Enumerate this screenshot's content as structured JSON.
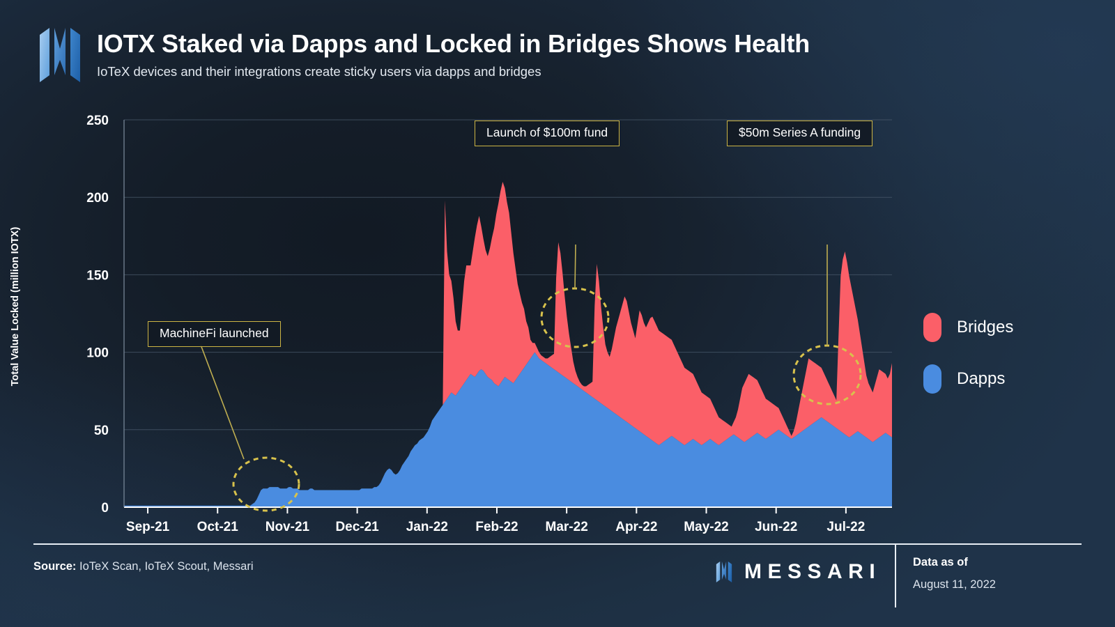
{
  "header": {
    "title": "IOTX Staked via Dapps and Locked in Bridges Shows Health",
    "subtitle": "IoTeX devices and their integrations create sticky users via dapps and bridges",
    "logo_icon": "messari-logo-icon"
  },
  "legend": {
    "items": [
      {
        "label": "Bridges",
        "color": "#fb5f68"
      },
      {
        "label": "Dapps",
        "color": "#4a8ce0"
      }
    ]
  },
  "annotations": [
    {
      "id": "machinefi",
      "label": "MachineFi launched"
    },
    {
      "id": "fund100m",
      "label": "Launch of $100m fund"
    },
    {
      "id": "series-a",
      "label": "$50m Series A funding"
    }
  ],
  "footer": {
    "source_label": "Source:",
    "source_value": "IoTeX Scan, IoTeX Scout, Messari",
    "brand": "MESSARI",
    "brand_logo_icon": "messari-logo-icon",
    "data_as_of_label": "Data as of",
    "data_as_of_value": "August 11, 2022"
  },
  "chart_data": {
    "type": "area",
    "stacked": true,
    "title": "IOTX Staked via Dapps and Locked in Bridges Shows Health",
    "subtitle": "IoTeX devices and their integrations create sticky users via dapps and bridges",
    "xlabel": "",
    "ylabel": "Total Value Locked (million IOTX)",
    "ylim": [
      0,
      250
    ],
    "yticks": [
      0,
      50,
      100,
      150,
      200,
      250
    ],
    "xticks": [
      "Sep-21",
      "Oct-21",
      "Nov-21",
      "Dec-21",
      "Jan-22",
      "Feb-22",
      "Mar-22",
      "Apr-22",
      "May-22",
      "Jun-22",
      "Jul-22"
    ],
    "grid": true,
    "legend_position": "right",
    "x_range": [
      "2021-09-01",
      "2022-08-11"
    ],
    "annotations": [
      {
        "text": "MachineFi launched",
        "x": "2021-11-05",
        "y": 12
      },
      {
        "text": "Launch of $100m fund",
        "x": "2022-03-10",
        "y": 195
      },
      {
        "text": "$50m Series A funding",
        "x": "2022-07-05",
        "y": 150
      }
    ],
    "series": [
      {
        "name": "Dapps",
        "color": "#4a8ce0",
        "values": [
          1,
          1,
          1,
          1,
          1,
          1,
          1,
          1,
          1,
          1,
          1,
          1,
          1,
          1,
          1,
          1,
          1,
          1,
          1,
          1,
          1,
          1,
          1,
          1,
          1,
          1,
          1,
          1,
          1,
          1,
          1,
          1,
          1,
          1,
          1,
          1,
          1,
          1,
          1,
          1,
          1,
          1,
          1,
          1,
          1,
          1,
          1,
          1,
          1,
          1,
          1,
          1,
          1,
          1,
          1,
          1,
          1,
          1,
          1,
          1,
          2,
          3,
          5,
          8,
          11,
          12,
          12,
          12,
          13,
          13,
          13,
          13,
          13,
          12,
          12,
          12,
          12,
          13,
          13,
          12,
          12,
          12,
          11,
          11,
          11,
          11,
          11,
          12,
          12,
          11,
          11,
          11,
          11,
          11,
          11,
          11,
          11,
          11,
          11,
          11,
          11,
          11,
          11,
          11,
          11,
          11,
          11,
          11,
          11,
          11,
          11,
          12,
          12,
          12,
          12,
          12,
          12,
          13,
          13,
          14,
          16,
          19,
          22,
          24,
          25,
          24,
          22,
          21,
          22,
          24,
          27,
          29,
          31,
          33,
          36,
          38,
          40,
          41,
          43,
          44,
          45,
          47,
          49,
          52,
          56,
          58,
          60,
          62,
          64,
          66,
          68,
          70,
          72,
          74,
          73,
          72,
          74,
          76,
          78,
          80,
          82,
          84,
          86,
          85,
          84,
          86,
          88,
          89,
          88,
          86,
          84,
          83,
          82,
          80,
          79,
          78,
          80,
          82,
          84,
          83,
          82,
          81,
          80,
          82,
          84,
          86,
          88,
          90,
          92,
          94,
          96,
          98,
          100,
          98,
          96,
          95,
          94,
          93,
          92,
          91,
          90,
          89,
          88,
          87,
          86,
          85,
          84,
          83,
          82,
          81,
          80,
          79,
          78,
          77,
          76,
          75,
          74,
          73,
          72,
          71,
          70,
          69,
          68,
          67,
          66,
          65,
          64,
          63,
          62,
          61,
          60,
          59,
          58,
          57,
          56,
          55,
          54,
          53,
          52,
          51,
          50,
          49,
          48,
          47,
          46,
          45,
          44,
          43,
          42,
          41,
          40,
          41,
          42,
          43,
          44,
          45,
          46,
          45,
          44,
          43,
          42,
          41,
          40,
          41,
          42,
          43,
          44,
          43,
          42,
          41,
          40,
          41,
          42,
          43,
          44,
          43,
          42,
          41,
          40,
          41,
          42,
          43,
          44,
          45,
          46,
          47,
          46,
          45,
          44,
          43,
          42,
          43,
          44,
          45,
          46,
          47,
          48,
          47,
          46,
          45,
          44,
          45,
          46,
          47,
          48,
          49,
          50,
          49,
          48,
          47,
          46,
          45,
          44,
          45,
          46,
          47,
          48,
          49,
          50,
          51,
          52,
          53,
          54,
          55,
          56,
          57,
          58,
          57,
          56,
          55,
          54,
          53,
          52,
          51,
          50,
          49,
          48,
          47,
          46,
          45,
          46,
          47,
          48,
          49,
          48,
          47,
          46,
          45,
          44,
          43,
          42,
          43,
          44,
          45,
          46,
          47,
          48,
          47,
          46,
          45
        ]
      },
      {
        "name": "Bridges",
        "color": "#fb5f68",
        "values": [
          0,
          0,
          0,
          0,
          0,
          0,
          0,
          0,
          0,
          0,
          0,
          0,
          0,
          0,
          0,
          0,
          0,
          0,
          0,
          0,
          0,
          0,
          0,
          0,
          0,
          0,
          0,
          0,
          0,
          0,
          0,
          0,
          0,
          0,
          0,
          0,
          0,
          0,
          0,
          0,
          0,
          0,
          0,
          0,
          0,
          0,
          0,
          0,
          0,
          0,
          0,
          0,
          0,
          0,
          0,
          0,
          0,
          0,
          0,
          0,
          0,
          0,
          0,
          0,
          0,
          0,
          0,
          0,
          0,
          0,
          0,
          0,
          0,
          0,
          0,
          0,
          0,
          0,
          0,
          0,
          0,
          0,
          0,
          0,
          0,
          0,
          0,
          0,
          0,
          0,
          0,
          0,
          0,
          0,
          0,
          0,
          0,
          0,
          0,
          0,
          0,
          0,
          0,
          0,
          0,
          0,
          0,
          0,
          0,
          0,
          0,
          0,
          0,
          0,
          0,
          0,
          0,
          0,
          0,
          0,
          0,
          0,
          0,
          0,
          0,
          0,
          0,
          0,
          0,
          0,
          0,
          0,
          0,
          0,
          0,
          0,
          0,
          0,
          0,
          0,
          0,
          0,
          0,
          0,
          0,
          0,
          0,
          0,
          0,
          0,
          130,
          95,
          78,
          72,
          62,
          48,
          40,
          38,
          52,
          66,
          74,
          72,
          70,
          80,
          90,
          96,
          100,
          92,
          85,
          80,
          78,
          84,
          92,
          100,
          110,
          118,
          124,
          128,
          122,
          114,
          108,
          96,
          84,
          72,
          60,
          52,
          44,
          38,
          28,
          22,
          12,
          8,
          6,
          5,
          4,
          3,
          3,
          3,
          4,
          6,
          8,
          10,
          60,
          84,
          78,
          66,
          52,
          40,
          30,
          22,
          14,
          9,
          6,
          4,
          3,
          3,
          4,
          6,
          8,
          10,
          60,
          88,
          78,
          62,
          50,
          40,
          36,
          34,
          40,
          48,
          56,
          62,
          68,
          74,
          80,
          78,
          72,
          66,
          62,
          58,
          68,
          78,
          76,
          72,
          70,
          74,
          78,
          80,
          78,
          76,
          74,
          72,
          70,
          68,
          66,
          64,
          62,
          60,
          58,
          56,
          54,
          52,
          50,
          48,
          46,
          44,
          42,
          40,
          38,
          36,
          34,
          32,
          30,
          28,
          26,
          24,
          22,
          20,
          18,
          16,
          14,
          12,
          10,
          8,
          6,
          8,
          12,
          18,
          26,
          34,
          38,
          40,
          42,
          40,
          38,
          36,
          34,
          32,
          30,
          28,
          26,
          24,
          22,
          20,
          18,
          16,
          14,
          12,
          10,
          8,
          6,
          4,
          2,
          4,
          8,
          14,
          20,
          26,
          32,
          38,
          44,
          42,
          40,
          38,
          36,
          34,
          32,
          30,
          28,
          26,
          24,
          22,
          20,
          18,
          60,
          100,
          112,
          118,
          112,
          104,
          96,
          88,
          80,
          72,
          64,
          56,
          48,
          40,
          36,
          34,
          32,
          36,
          40,
          44,
          42,
          40,
          38,
          36,
          40,
          48
        ]
      }
    ]
  }
}
